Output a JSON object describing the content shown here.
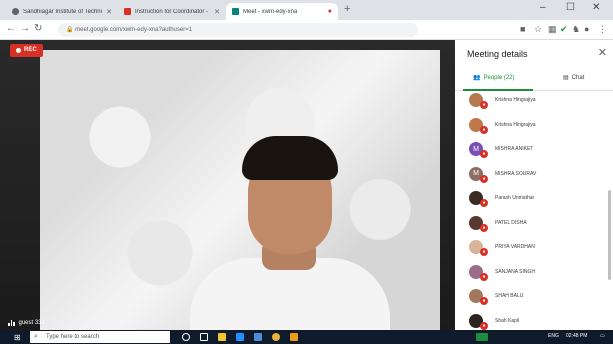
{
  "browser": {
    "tabs": [
      {
        "title": "Sandhiagar Institute of Techno...",
        "favicon_color": "#5f6368",
        "active": false
      },
      {
        "title": "Instruction for Coordinator - sc...",
        "favicon_color": "#d93025",
        "active": false
      },
      {
        "title": "Meet - xwm-edy-xna",
        "favicon_color": "#00897b",
        "active": true
      }
    ],
    "new_tab": "+",
    "window_controls": [
      "–",
      "☐",
      "✕"
    ],
    "url": "meet.google.com/xwm-edy-xna?authuser=1"
  },
  "video": {
    "rec_label": "REC",
    "participant_label": "guest 331"
  },
  "panel": {
    "title": "Meeting details",
    "close": "✕",
    "tabs": {
      "people": "People (22)",
      "chat": "Chat"
    },
    "participants": [
      {
        "name": "Krishna Hingrajiya",
        "initial": "",
        "color": "#b5794f"
      },
      {
        "name": "Krishna Hingrajiya",
        "initial": "",
        "color": "#c0784a"
      },
      {
        "name": "MISHRA ANIKET",
        "initial": "M",
        "color": "#7b4fb3"
      },
      {
        "name": "MISHRA SOURAV",
        "initial": "M",
        "color": "#8d6e63"
      },
      {
        "name": "Parash Unmathar",
        "initial": "",
        "color": "#3a2a22"
      },
      {
        "name": "PATEL DISHA",
        "initial": "",
        "color": "#5a3a30"
      },
      {
        "name": "PRIYA VARDHAN",
        "initial": "",
        "color": "#d9b49a"
      },
      {
        "name": "SANJANA SINGH",
        "initial": "",
        "color": "#9c6b8a"
      },
      {
        "name": "SHAH BALU",
        "initial": "",
        "color": "#a3785c"
      },
      {
        "name": "Shah Kapil",
        "initial": "",
        "color": "#2b2320"
      }
    ]
  },
  "taskbar": {
    "search_placeholder": "Type here to search",
    "tray_text": "ENG",
    "time": "02:48 PM"
  }
}
